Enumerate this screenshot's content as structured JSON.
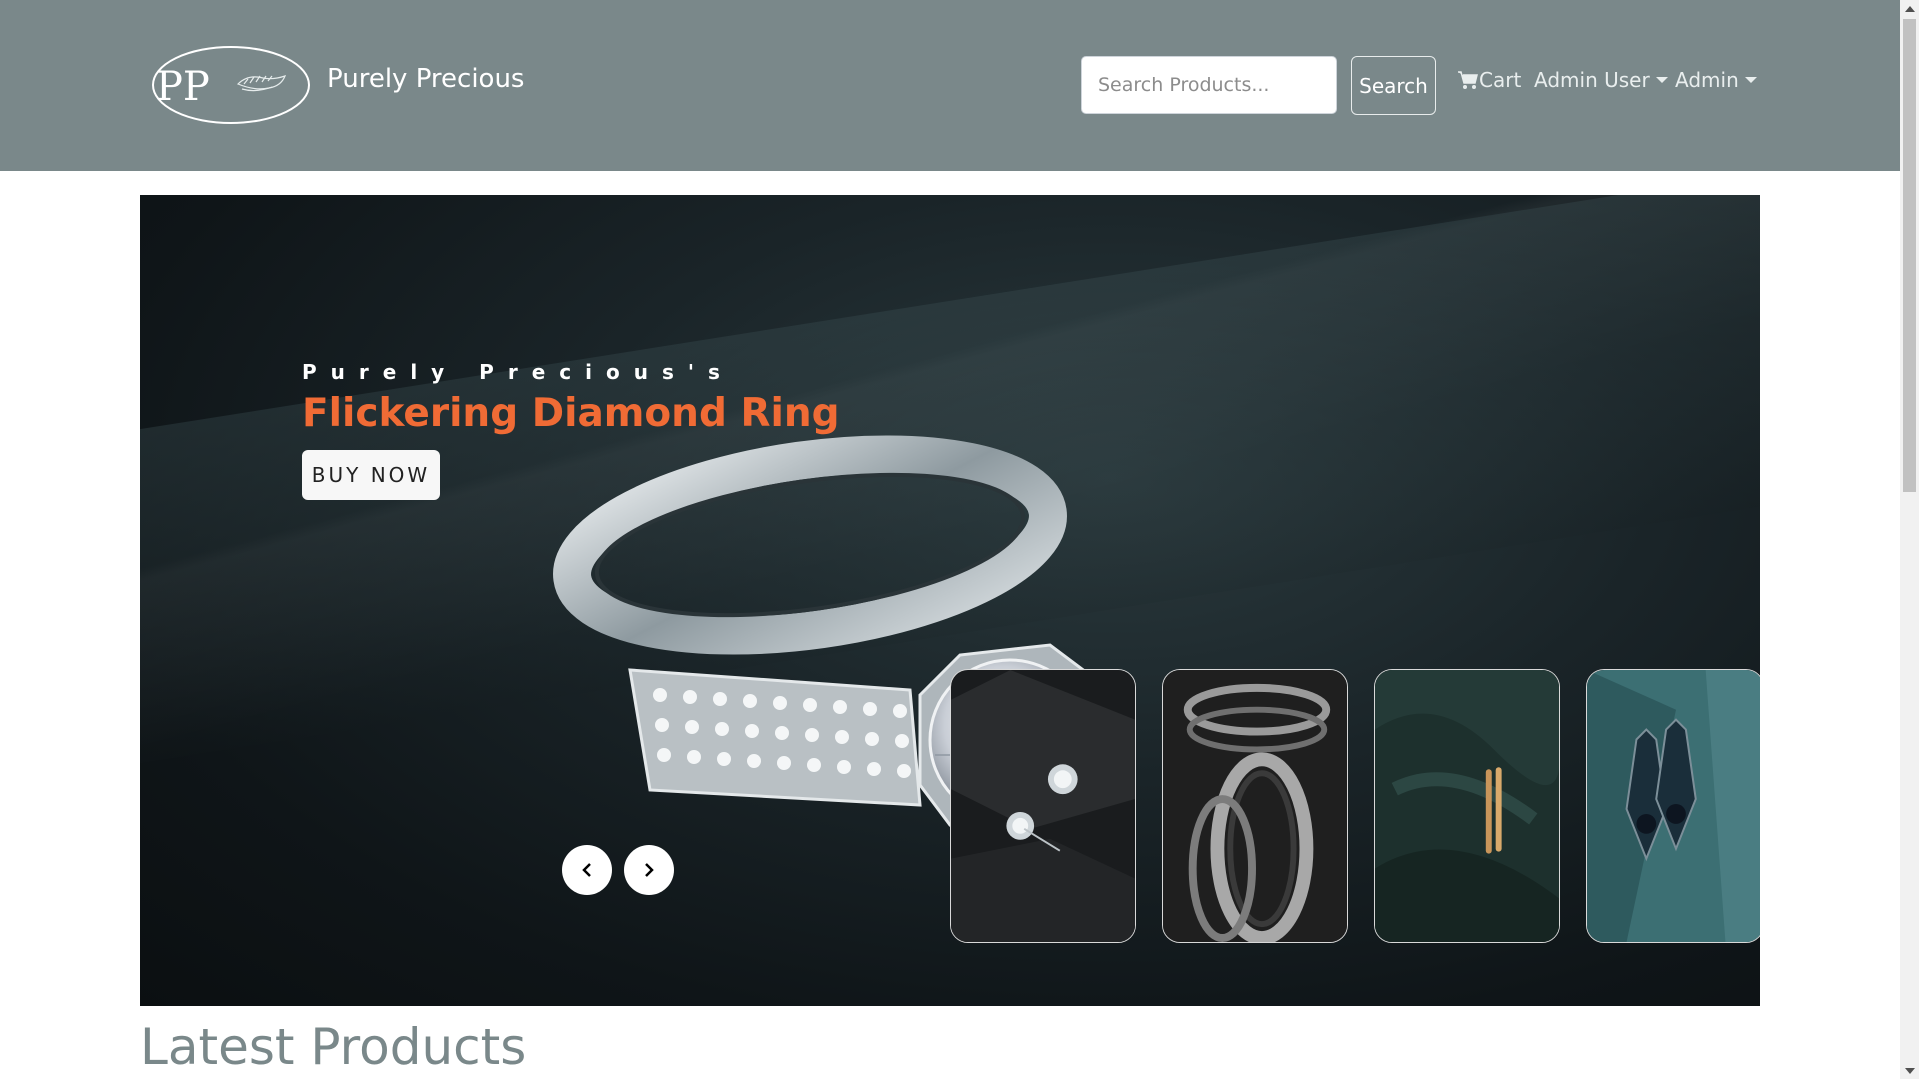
{
  "header": {
    "brand_name": "Purely Precious",
    "logo_text": "PP",
    "search": {
      "placeholder": "Search Products...",
      "value": ""
    },
    "search_button": "Search",
    "cart_label": "Cart",
    "admin_user_label": "Admin User",
    "admin_label": "Admin"
  },
  "hero": {
    "kicker": "Purely Precious's",
    "title": "Flickering Diamond Ring",
    "cta": "BUY NOW",
    "prev_icon": "chevron-left-icon",
    "next_icon": "chevron-right-icon",
    "thumbnails": [
      {
        "name": "diamond-stud-earrings"
      },
      {
        "name": "silver-bangles"
      },
      {
        "name": "gold-rings"
      },
      {
        "name": "drop-earrings"
      }
    ]
  },
  "main": {
    "section_title": "Latest Products"
  },
  "colors": {
    "navbar": "#7a888a",
    "accent_title": "#f06b35",
    "section_title": "#7a888a"
  }
}
